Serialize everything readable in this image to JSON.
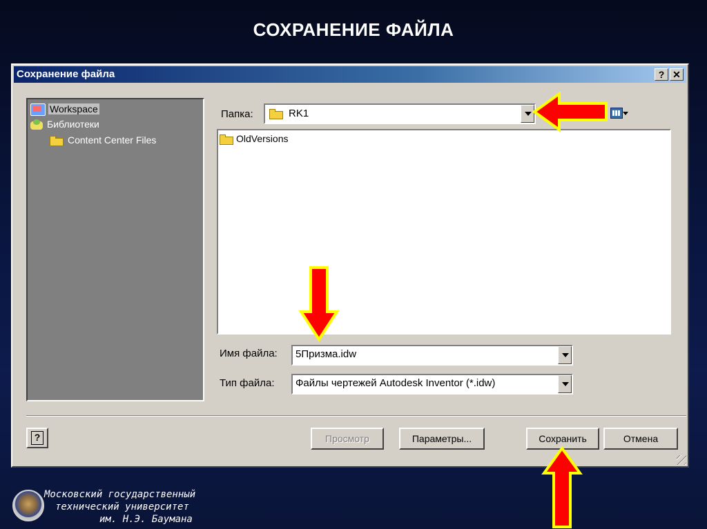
{
  "slide": {
    "title": "СОХРАНЕНИЕ ФАЙЛА"
  },
  "dialog": {
    "title": "Сохранение файла",
    "help_button": "?",
    "close_button": "✕"
  },
  "left_pane": {
    "items": [
      {
        "label": "Workspace",
        "icon": "workspace-icon",
        "selected": true
      },
      {
        "label": "Библиотеки",
        "icon": "libraries-icon"
      },
      {
        "label": "Content Center Files",
        "icon": "folder-icon"
      }
    ]
  },
  "folder": {
    "label": "Папка:",
    "value": "RK1"
  },
  "file_list": {
    "items": [
      {
        "name": "OldVersions",
        "icon": "folder-icon"
      }
    ]
  },
  "file_name": {
    "label": "Имя файла:",
    "value": "5Призма.idw"
  },
  "file_type": {
    "label": "Тип файла:",
    "value": "Файлы чертежей Autodesk Inventor (*.idw)"
  },
  "buttons": {
    "preview": "Просмотр",
    "options": "Параметры...",
    "save": "Сохранить",
    "cancel": "Отмена",
    "help": "?"
  },
  "footer": {
    "line1": "Московский государственный",
    "line2": "технический университет",
    "line3": "им. Н.Э. Баумана"
  },
  "colors": {
    "arrow_fill": "#ff0000",
    "arrow_outline": "#ffff00",
    "titlebar_start": "#0a246a",
    "dialog_bg": "#d4d0c8"
  }
}
